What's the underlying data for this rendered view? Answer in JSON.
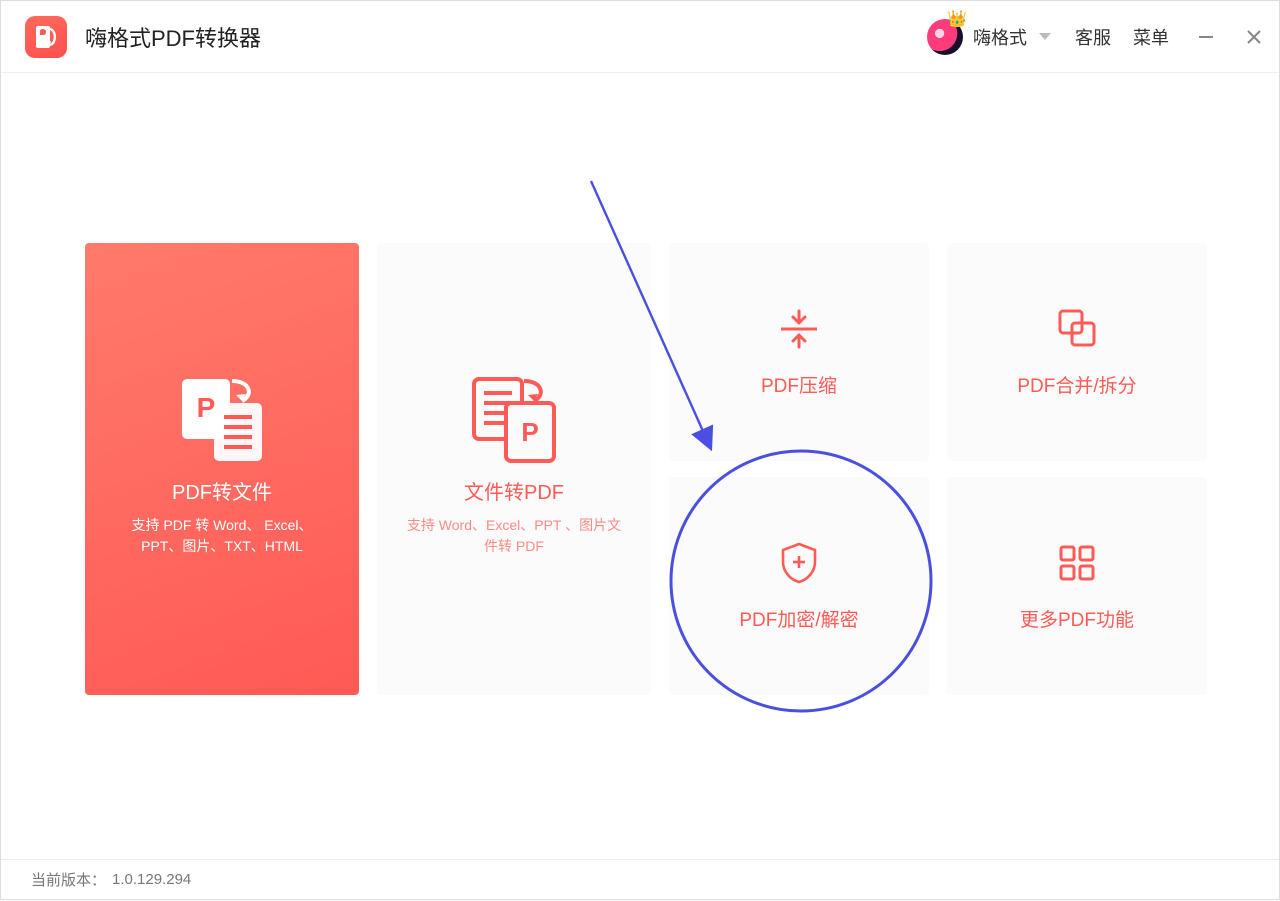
{
  "app": {
    "title": "嗨格式PDF转换器"
  },
  "user": {
    "name": "嗨格式"
  },
  "links": {
    "kefu": "客服",
    "menu": "菜单"
  },
  "tiles": {
    "pdf2file": {
      "title": "PDF转文件",
      "sub": "支持 PDF 转 Word、 Excel、PPT、图片、TXT、HTML"
    },
    "file2pdf": {
      "title": "文件转PDF",
      "sub": "支持 Word、Excel、PPT 、图片文件转 PDF"
    },
    "compress": {
      "title": "PDF压缩"
    },
    "mergesplit": {
      "title": "PDF合并/拆分"
    },
    "encrypt": {
      "title": "PDF加密/解密"
    },
    "more": {
      "title": "更多PDF功能"
    }
  },
  "footer": {
    "label": "当前版本：",
    "version": "1.0.129.294"
  },
  "colors": {
    "accent": "#ff5a55",
    "annotation": "#4a4fe0"
  }
}
